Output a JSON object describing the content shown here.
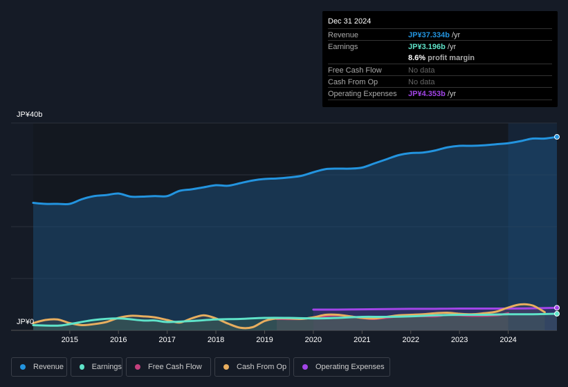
{
  "tooltip": {
    "date": "Dec 31 2024",
    "rows": [
      {
        "label": "Revenue",
        "value": "JP¥37.334b",
        "unit": " /yr",
        "color": "#2394df"
      },
      {
        "label": "Earnings",
        "value": "JP¥3.196b",
        "unit": " /yr",
        "color": "#5fe3c9"
      },
      {
        "label": "",
        "value": "8.6%",
        "unit": " profit margin",
        "color": "#ffffff"
      },
      {
        "label": "Free Cash Flow",
        "value": "No data",
        "unit": "",
        "color": "#666666"
      },
      {
        "label": "Cash From Op",
        "value": "No data",
        "unit": "",
        "color": "#666666"
      },
      {
        "label": "Operating Expenses",
        "value": "JP¥4.353b",
        "unit": " /yr",
        "color": "#a245e8"
      }
    ]
  },
  "legend": [
    {
      "label": "Revenue",
      "color": "#2394df"
    },
    {
      "label": "Earnings",
      "color": "#5fe3c9"
    },
    {
      "label": "Free Cash Flow",
      "color": "#c4407d"
    },
    {
      "label": "Cash From Op",
      "color": "#e8ae5f"
    },
    {
      "label": "Operating Expenses",
      "color": "#a245e8"
    }
  ],
  "chart_data": {
    "type": "area",
    "title": "",
    "ylabel_top": "JP¥40b",
    "ylabel_bottom": "JP¥0",
    "ylim": [
      0,
      40
    ],
    "xlim": [
      2014.25,
      2025.0
    ],
    "x_ticks": [
      "2015",
      "2016",
      "2017",
      "2018",
      "2019",
      "2020",
      "2021",
      "2022",
      "2023",
      "2024"
    ],
    "forecast_shade_start": 2024.0,
    "grid": true,
    "series": [
      {
        "name": "Revenue",
        "color": "#2394df",
        "x": [
          2014.25,
          2014.5,
          2014.75,
          2015.0,
          2015.25,
          2015.5,
          2015.75,
          2016.0,
          2016.25,
          2016.5,
          2016.75,
          2017.0,
          2017.25,
          2017.5,
          2017.75,
          2018.0,
          2018.25,
          2018.5,
          2018.75,
          2019.0,
          2019.25,
          2019.5,
          2019.75,
          2020.0,
          2020.25,
          2020.5,
          2020.75,
          2021.0,
          2021.25,
          2021.5,
          2021.75,
          2022.0,
          2022.25,
          2022.5,
          2022.75,
          2023.0,
          2023.25,
          2023.5,
          2023.75,
          2024.0,
          2024.25,
          2024.5,
          2024.75,
          2025.0
        ],
        "values": [
          24.6,
          24.4,
          24.4,
          24.4,
          25.3,
          25.9,
          26.1,
          26.4,
          25.8,
          25.8,
          25.9,
          25.9,
          26.9,
          27.2,
          27.6,
          28.0,
          27.9,
          28.4,
          28.9,
          29.2,
          29.3,
          29.5,
          29.8,
          30.5,
          31.1,
          31.2,
          31.2,
          31.4,
          32.2,
          33.0,
          33.8,
          34.2,
          34.3,
          34.7,
          35.3,
          35.6,
          35.6,
          35.7,
          35.9,
          36.1,
          36.5,
          37.0,
          37.0,
          37.33
        ]
      },
      {
        "name": "Earnings",
        "color": "#5fe3c9",
        "x": [
          2014.25,
          2014.75,
          2015.0,
          2015.5,
          2016.0,
          2016.5,
          2016.75,
          2017.0,
          2017.5,
          2018.0,
          2018.5,
          2019.0,
          2019.5,
          2020.0,
          2020.5,
          2021.0,
          2021.5,
          2022.0,
          2022.5,
          2023.0,
          2023.5,
          2024.0,
          2024.5,
          2025.0
        ],
        "values": [
          1.0,
          0.9,
          1.2,
          2.0,
          2.3,
          1.9,
          1.9,
          1.6,
          1.8,
          2.1,
          2.2,
          2.4,
          2.4,
          2.3,
          2.4,
          2.6,
          2.6,
          2.7,
          2.9,
          3.0,
          3.0,
          3.1,
          3.1,
          3.196
        ]
      },
      {
        "name": "Free Cash Flow",
        "color": "#c4407d",
        "x": [
          2019.25,
          2019.75,
          2020.0,
          2020.5,
          2021.0,
          2021.25,
          2021.75,
          2022.0,
          2022.5,
          2022.75,
          2023.25,
          2023.75,
          2024.0
        ],
        "values": [
          2.2,
          2.2,
          2.5,
          2.9,
          2.4,
          2.2,
          2.7,
          2.8,
          2.7,
          3.0,
          2.8,
          2.9,
          3.3
        ]
      },
      {
        "name": "Cash From Op",
        "color": "#e8ae5f",
        "x": [
          2014.25,
          2014.5,
          2014.75,
          2015.0,
          2015.25,
          2015.5,
          2015.75,
          2016.0,
          2016.25,
          2016.5,
          2016.75,
          2017.0,
          2017.25,
          2017.5,
          2017.75,
          2018.0,
          2018.25,
          2018.5,
          2018.75,
          2019.0,
          2019.25,
          2019.5,
          2019.75,
          2020.0,
          2020.25,
          2020.5,
          2020.75,
          2021.0,
          2021.25,
          2021.5,
          2021.75,
          2022.0,
          2022.25,
          2022.5,
          2022.75,
          2023.0,
          2023.25,
          2023.5,
          2023.75,
          2024.0,
          2024.25,
          2024.5,
          2024.75
        ],
        "values": [
          1.4,
          2.0,
          2.1,
          1.4,
          1.0,
          1.2,
          1.6,
          2.4,
          2.8,
          2.7,
          2.5,
          2.0,
          1.5,
          2.3,
          2.9,
          2.3,
          1.3,
          0.5,
          0.6,
          1.8,
          2.3,
          2.3,
          2.2,
          2.5,
          3.0,
          3.0,
          2.7,
          2.4,
          2.3,
          2.6,
          2.9,
          3.0,
          3.1,
          3.3,
          3.4,
          3.2,
          3.1,
          3.3,
          3.6,
          4.4,
          5.0,
          4.8,
          3.5
        ]
      },
      {
        "name": "Operating Expenses",
        "color": "#a245e8",
        "x": [
          2020.0,
          2020.5,
          2021.0,
          2021.5,
          2022.0,
          2022.5,
          2023.0,
          2023.5,
          2024.0,
          2024.5,
          2025.0
        ],
        "values": [
          4.0,
          4.0,
          4.05,
          4.1,
          4.15,
          4.15,
          4.2,
          4.2,
          4.2,
          4.25,
          4.353
        ]
      }
    ]
  }
}
